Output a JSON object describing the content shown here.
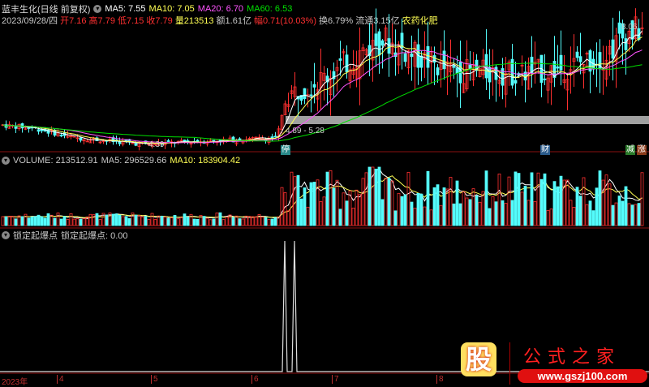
{
  "header": {
    "title": "蓝丰生化(日线 前复权)",
    "ma5": "MA5: 7.55",
    "ma10": "MA10: 7.05",
    "ma20": "MA20: 6.70",
    "ma60": "MA60: 6.53"
  },
  "quote": {
    "date": "2023/09/28/四",
    "open": "开7.16",
    "high": "高7.79",
    "low": "低7.15",
    "close": "收7.79",
    "volume": "量213513",
    "amount": "额1.61亿",
    "change": "幅0.71(10.03%)",
    "turnover": "换6.79%",
    "float": "流通3.15亿",
    "sector": "农药化肥"
  },
  "annotations": {
    "high": "8.06",
    "low": "4.39",
    "gap": "4.89 - 5.28",
    "stop": "停",
    "finance": "财",
    "reduce": "减",
    "rise": "涨"
  },
  "volume_panel": {
    "label": "VOLUME: 213512.91",
    "ma5": "MA5: 296529.66",
    "ma10": "MA10: 183904.42"
  },
  "indicator_panel": {
    "name": "锁定起爆点",
    "value": "锁定起爆点: 0.00"
  },
  "xaxis": {
    "year": "2023年",
    "months": [
      "4",
      "5",
      "6",
      "7",
      "8"
    ]
  },
  "watermark": {
    "char": "股",
    "name": "公式之家",
    "url": "www.gszj100.com"
  },
  "colors": {
    "up": "#ff3030",
    "down": "#54fcfc",
    "ma5": "#ffffff",
    "ma10": "#ffff54",
    "ma20": "#ff54ff",
    "ma60": "#00e000"
  }
}
